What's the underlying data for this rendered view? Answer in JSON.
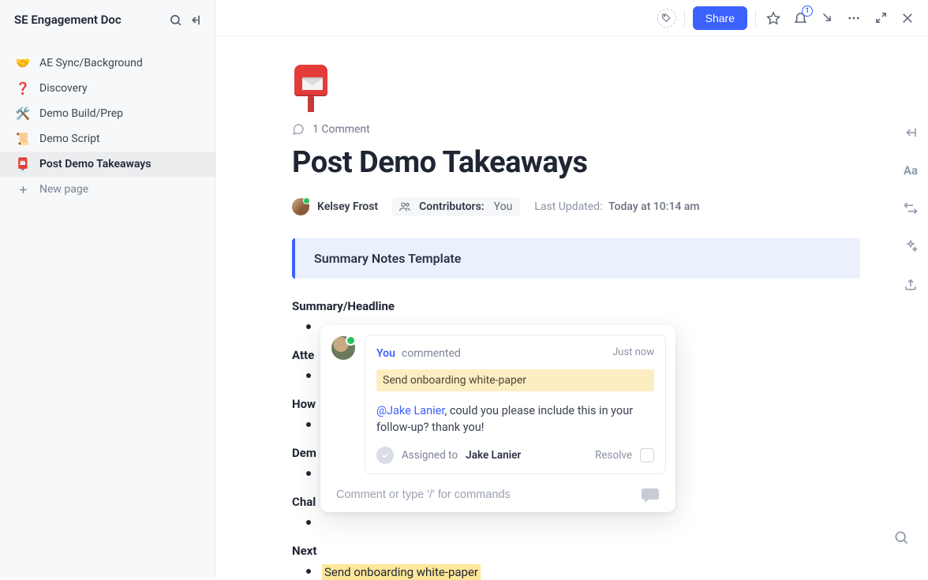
{
  "sidebar": {
    "title": "SE Engagement Doc",
    "items": [
      {
        "emoji": "🤝",
        "label": "AE Sync/Background"
      },
      {
        "emoji": "❓",
        "label": "Discovery"
      },
      {
        "emoji": "🛠️",
        "label": "Demo Build/Prep"
      },
      {
        "emoji": "📜",
        "label": "Demo Script"
      },
      {
        "emoji": "📮",
        "label": "Post Demo Takeaways"
      }
    ],
    "new_page_label": "New page"
  },
  "topbar": {
    "share_label": "Share",
    "notification_count": "1"
  },
  "page": {
    "comment_count_label": "1 Comment",
    "title": "Post Demo Takeaways",
    "author_name": "Kelsey Frost",
    "contributors_label": "Contributors",
    "contributors_value": "You",
    "updated_label": "Last Updated:",
    "updated_value": "Today at 10:14 am",
    "callout_text": "Summary Notes Template",
    "sections": [
      "Summary/Headline",
      "Atte",
      "How",
      "Dem",
      "Chal",
      "Next"
    ],
    "highlighted_bullet": "Send onboarding white-paper"
  },
  "popover": {
    "you_label": "You",
    "action_verb": "commented",
    "timestamp": "Just now",
    "highlight_text": "Send onboarding white-paper",
    "mention_name": "@Jake Lanier",
    "body_rest": ", could you please include this in your follow-up? thank you!",
    "assigned_to_label": "Assigned to",
    "assigned_to_name": "Jake Lanier",
    "resolve_label": "Resolve",
    "input_placeholder": "Comment or type '/' for commands"
  }
}
